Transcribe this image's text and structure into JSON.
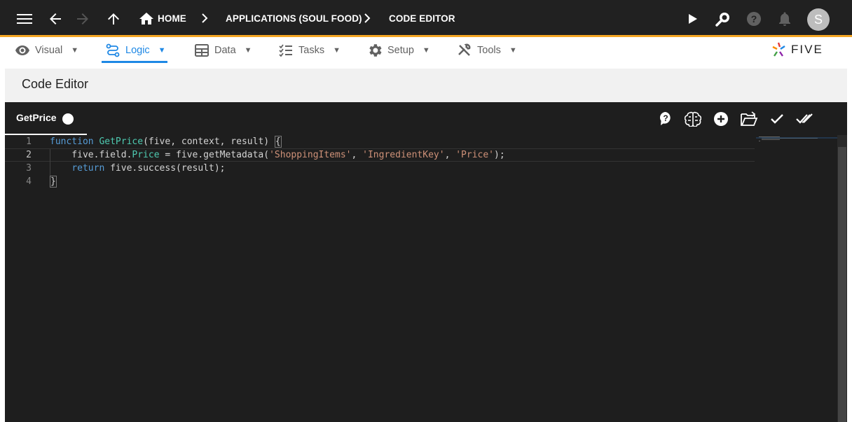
{
  "topbar": {
    "breadcrumbs": [
      "HOME",
      "APPLICATIONS (SOUL FOOD)",
      "CODE EDITOR"
    ],
    "avatar_initial": "S",
    "icons": [
      "menu-icon",
      "back-arrow-icon",
      "forward-arrow-icon",
      "up-arrow-icon",
      "home-icon",
      "play-icon",
      "search-icon",
      "help-icon",
      "bell-icon"
    ]
  },
  "menu": {
    "items": [
      {
        "label": "Visual",
        "icon": "eye-icon",
        "arrow": "▼"
      },
      {
        "label": "Logic",
        "icon": "logic-flow-icon",
        "arrow": "▼",
        "active": true
      },
      {
        "label": "Data",
        "icon": "table-icon",
        "arrow": "▼"
      },
      {
        "label": "Tasks",
        "icon": "checklist-icon",
        "arrow": "▼"
      },
      {
        "label": "Setup",
        "icon": "gear-icon",
        "arrow": "▼"
      },
      {
        "label": "Tools",
        "icon": "tools-icon",
        "arrow": "▼"
      }
    ],
    "logo_text": "FIVE"
  },
  "page": {
    "title": "Code Editor"
  },
  "editor": {
    "tab_label": "GetPrice",
    "toolbar_icons": [
      "help-icon",
      "brain-icon",
      "add-icon",
      "open-folder-icon",
      "check-icon",
      "double-check-icon"
    ],
    "current_line": 2,
    "lines": [
      {
        "number": "1"
      },
      {
        "number": "2"
      },
      {
        "number": "3"
      },
      {
        "number": "4"
      }
    ],
    "code": {
      "l1_kw": "function",
      "l1_fn": "GetPrice",
      "l1_rest": "(five, context, result) ",
      "l1_brace": "{",
      "l2_a": "    five.field.",
      "l2_prop": "Price",
      "l2_b": " = five.getMetadata(",
      "l2_s1": "'ShoppingItems'",
      "l2_c1": ", ",
      "l2_s2": "'IngredientKey'",
      "l2_c2": ", ",
      "l2_s3": "'Price'",
      "l2_end": ");",
      "l3_indent": "    ",
      "l3_kw": "return",
      "l3_rest": " five.success(result);",
      "l4_brace": "}"
    }
  },
  "colors": {
    "topbar_bg": "#212121",
    "accent_orange": "#f5a623",
    "active_blue": "#1e88e5",
    "editor_bg": "#1e1e1e"
  }
}
